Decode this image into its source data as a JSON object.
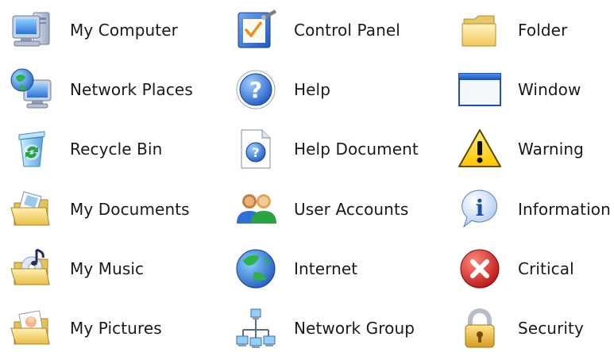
{
  "icons": {
    "col1": [
      {
        "label": "My Computer",
        "icon": "my-computer-icon"
      },
      {
        "label": "Network Places",
        "icon": "network-places-icon"
      },
      {
        "label": "Recycle Bin",
        "icon": "recycle-bin-icon"
      },
      {
        "label": "My Documents",
        "icon": "my-documents-icon"
      },
      {
        "label": "My Music",
        "icon": "my-music-icon"
      },
      {
        "label": "My Pictures",
        "icon": "my-pictures-icon"
      }
    ],
    "col2": [
      {
        "label": "Control Panel",
        "icon": "control-panel-icon"
      },
      {
        "label": "Help",
        "icon": "help-icon"
      },
      {
        "label": "Help Document",
        "icon": "help-document-icon"
      },
      {
        "label": "User Accounts",
        "icon": "user-accounts-icon"
      },
      {
        "label": "Internet",
        "icon": "internet-icon"
      },
      {
        "label": "Network Group",
        "icon": "network-group-icon"
      }
    ],
    "col3": [
      {
        "label": "Folder",
        "icon": "folder-icon"
      },
      {
        "label": "Window",
        "icon": "window-icon"
      },
      {
        "label": "Warning",
        "icon": "warning-icon"
      },
      {
        "label": "Information",
        "icon": "information-icon"
      },
      {
        "label": "Critical",
        "icon": "critical-icon"
      },
      {
        "label": "Security",
        "icon": "security-icon"
      }
    ]
  },
  "colors": {
    "folder_yellow": "#f6d66a",
    "help_blue": "#2f6fd6",
    "critical_red": "#d21f1f",
    "warning_yellow": "#ffd200",
    "globe_green": "#2aa343",
    "globe_blue": "#2a63c8"
  }
}
